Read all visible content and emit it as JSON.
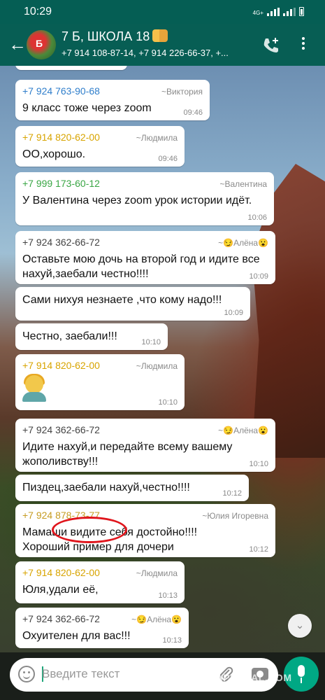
{
  "status_bar": {
    "time": "10:29",
    "network": "4G+"
  },
  "header": {
    "title": "7 Б, ШКОЛА  18",
    "subtitle": "+7 914 108-87-14, +7 914 226-66-37, +...",
    "back_icon": "arrow-left-icon",
    "add_call_icon": "phone-plus-icon",
    "menu_icon": "more-vertical-icon"
  },
  "messages": [
    {
      "phone": "+7 924 763-90-68",
      "alias": "~Виктория",
      "text": "9 класс тоже через zoom",
      "time": "09:46"
    },
    {
      "phone": "+7 914 820-62-00",
      "alias": "~Людмила",
      "text": "ОО,хорошо.",
      "time": "09:46"
    },
    {
      "phone": "+7 999 173-60-12",
      "alias": "~Валентина",
      "text": "У Валентина через zoom урок истории идёт.",
      "time": "10:06"
    },
    {
      "phone": "+7 924 362-66-72",
      "alias": "~😏Алёна😮",
      "text": "Оставьте мою дочь на второй год и идите все нахуй,заебали честно!!!!",
      "time": "10:09"
    },
    {
      "text": "Сами нихуя незнаете ,что кому надо!!!",
      "time": "10:09"
    },
    {
      "text": "Честно, заебали!!!",
      "time": "10:10"
    },
    {
      "phone": "+7 914 820-62-00",
      "alias": "~Людмила",
      "emoji": "woman-facepalming",
      "time": "10:10"
    },
    {
      "phone": "+7 924 362-66-72",
      "alias": "~😏Алёна😮",
      "text": "Идите нахуй,и передайте всему вашему жополивству!!!",
      "time": "10:10"
    },
    {
      "text": "Пиздец,заебали нахуй,честно!!!!",
      "time": "10:12"
    },
    {
      "phone": "+7 924 878-73-77",
      "alias": "~Юлия Игоревна",
      "text": "Мамаши видите себя достойно!!!! Хороший пример для дочери",
      "time": "10:12"
    },
    {
      "phone": "+7 914 820-62-00",
      "alias": "~Людмила",
      "text": "Юля,удали её,",
      "time": "10:13"
    },
    {
      "phone": "+7 924 362-66-72",
      "alias": "~😏Алёна😮",
      "text": "Охуителен для вас!!!",
      "time": "10:13"
    }
  ],
  "input": {
    "placeholder": "Введите текст"
  },
  "watermark": "YAPLAKAL.COM",
  "colors": {
    "header": "#075e54",
    "accent_green": "#00a884",
    "annotation_red": "#e0151c"
  }
}
